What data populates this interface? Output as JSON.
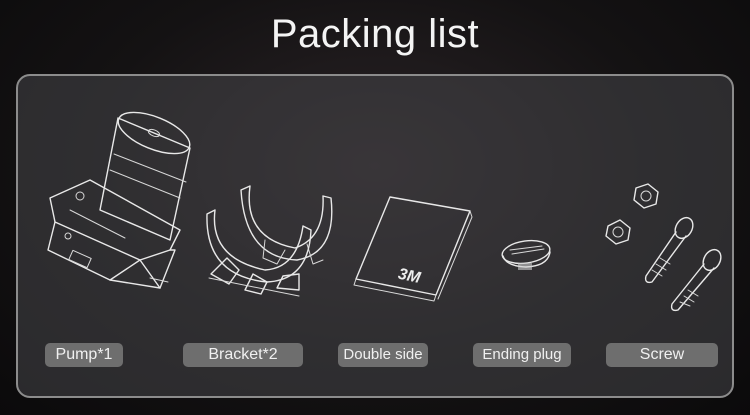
{
  "title": "Packing list",
  "items": [
    {
      "label": "Pump*1",
      "icon": "pump-icon"
    },
    {
      "label": "Bracket*2",
      "icon": "bracket-icon"
    },
    {
      "label": "Double side",
      "icon": "double-side-tape-icon",
      "tape_marking": "3M"
    },
    {
      "label": "Ending plug",
      "icon": "ending-plug-icon"
    },
    {
      "label": "Screw",
      "icon": "screw-icon"
    }
  ],
  "colors": {
    "label_bg": "#6e6e6e",
    "panel_border": "#8c8c8c",
    "text": "#f4f4f4"
  }
}
